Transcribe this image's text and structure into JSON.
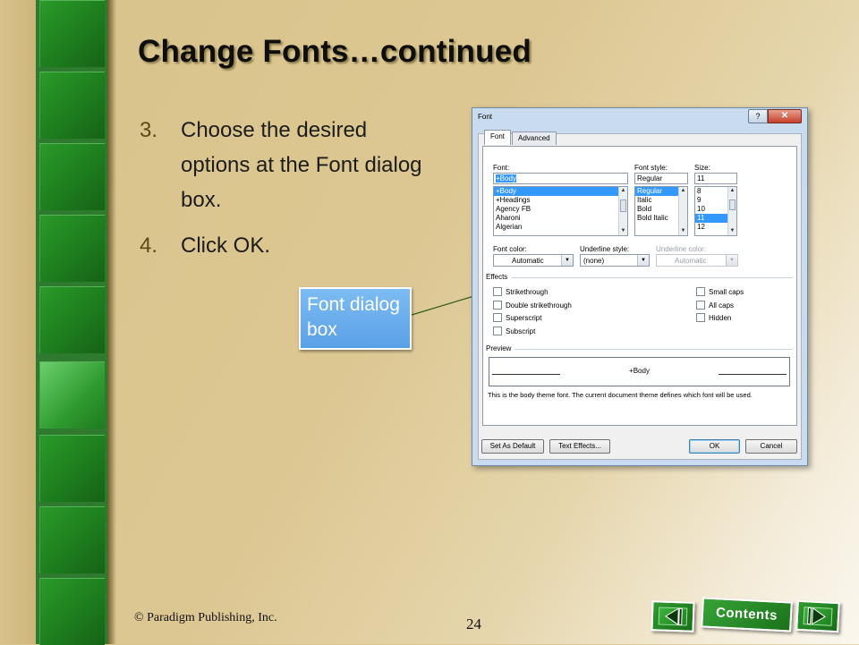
{
  "slide": {
    "title": "Change Fonts…continued",
    "steps": [
      {
        "number": "3.",
        "text": "Choose the desired options at the Font dialog box."
      },
      {
        "number": "4.",
        "text": "Click OK."
      }
    ],
    "callout": "Font dialog box",
    "footer": "© Paradigm Publishing, Inc.",
    "page_number": "24",
    "nav": {
      "prev_icon": "triangle-left-icon",
      "contents_label": "Contents",
      "next_icon": "triangle-right-icon"
    }
  },
  "dialog": {
    "title": "Font",
    "help_glyph": "?",
    "close_glyph": "✕",
    "tabs": [
      "Font",
      "Advanced"
    ],
    "font": {
      "label": "Font:",
      "value": "+Body",
      "items": [
        "+Body",
        "+Headings",
        "Agency FB",
        "Aharoni",
        "Algerian"
      ],
      "selected": "+Body"
    },
    "font_style": {
      "label": "Font style:",
      "value": "Regular",
      "items": [
        "Regular",
        "Italic",
        "Bold",
        "Bold Italic"
      ],
      "selected": "Regular"
    },
    "size": {
      "label": "Size:",
      "value": "11",
      "items": [
        "8",
        "9",
        "10",
        "11",
        "12"
      ],
      "selected": "11"
    },
    "font_color": {
      "label": "Font color:",
      "value": "Automatic"
    },
    "underline_style": {
      "label": "Underline style:",
      "value": "(none)"
    },
    "underline_color": {
      "label": "Underline color:",
      "value": "Automatic"
    },
    "effects": {
      "label": "Effects",
      "left": [
        "Strikethrough",
        "Double strikethrough",
        "Superscript",
        "Subscript"
      ],
      "right": [
        "Small caps",
        "All caps",
        "Hidden"
      ]
    },
    "preview": {
      "label": "Preview",
      "sample": "+Body",
      "description": "This is the body theme font. The current document theme defines which font will be used."
    },
    "buttons": {
      "set_default": "Set As Default",
      "text_effects": "Text Effects...",
      "ok": "OK",
      "cancel": "Cancel"
    }
  }
}
